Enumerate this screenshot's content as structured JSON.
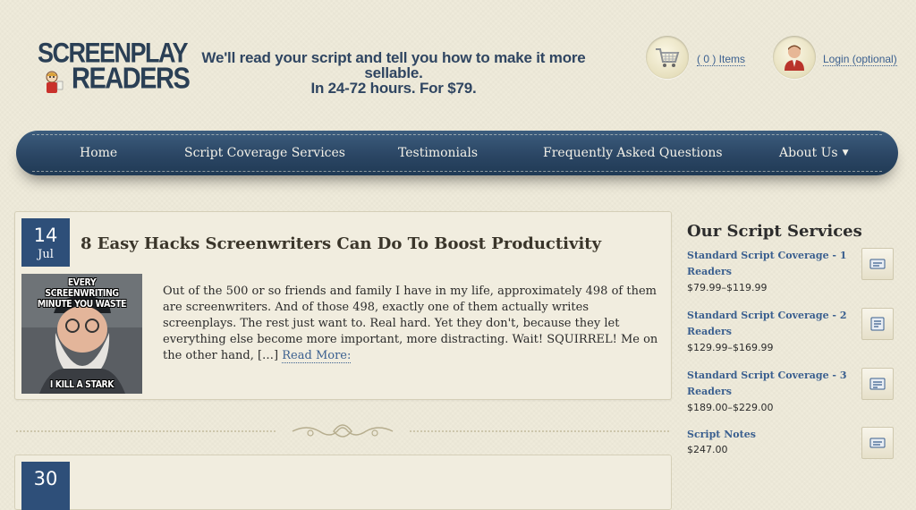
{
  "header": {
    "logo_line1": "SCREENPLAY",
    "logo_line2": "READERS",
    "tagline_line1": "We'll read your script and tell you how to make it more sellable.",
    "tagline_line2": "In 24-72 hours. For $79.",
    "cart_label": "( 0 ) Items",
    "login_label": "Login (optional)",
    "cart_icon": "shopping-cart-icon",
    "user_icon": "user-avatar-icon"
  },
  "nav": {
    "items": [
      {
        "label": "Home"
      },
      {
        "label": "Script Coverage Services"
      },
      {
        "label": "Testimonials"
      },
      {
        "label": "Frequently Asked Questions"
      },
      {
        "label": "About Us",
        "has_dropdown": true
      }
    ]
  },
  "posts": [
    {
      "day": "14",
      "month": "Jul",
      "title": "8 Easy Hacks Screenwriters Can Do To Boost Productivity",
      "thumb_caption_top": "EVERY SCREENWRITING MINUTE YOU WASTE",
      "thumb_caption_bottom": "I KILL A STARK",
      "excerpt": "Out of the 500 or so friends and family I have in my life, approximately 498 of them are screenwriters. And of those 498, exactly one of them actually writes screenplays.  The rest just want to.  Real hard.  Yet they don't, because they  let everything else become more important, more distracting. Wait! SQUIRREL! Me on the other hand, […]",
      "read_more": "Read More:"
    },
    {
      "day": "30",
      "title": ""
    }
  ],
  "sidebar": {
    "title": "Our Script Services",
    "services": [
      {
        "name": "Standard Script Coverage - 1 Readers",
        "price": "$79.99–$119.99",
        "icon": "coverage-1-icon"
      },
      {
        "name": "Standard Script Coverage - 2 Readers",
        "price": "$129.99–$169.99",
        "icon": "coverage-2-icon"
      },
      {
        "name": "Standard Script Coverage - 3 Readers",
        "price": "$189.00–$229.00",
        "icon": "coverage-3-icon"
      },
      {
        "name": "Script Notes",
        "price": "$247.00",
        "icon": "script-notes-icon"
      }
    ]
  },
  "colors": {
    "background": "#efebdb",
    "nav_bar": "#2b4664",
    "date_box": "#2e4f79",
    "link": "#3a5f8f",
    "logo": "#2a3f55"
  }
}
